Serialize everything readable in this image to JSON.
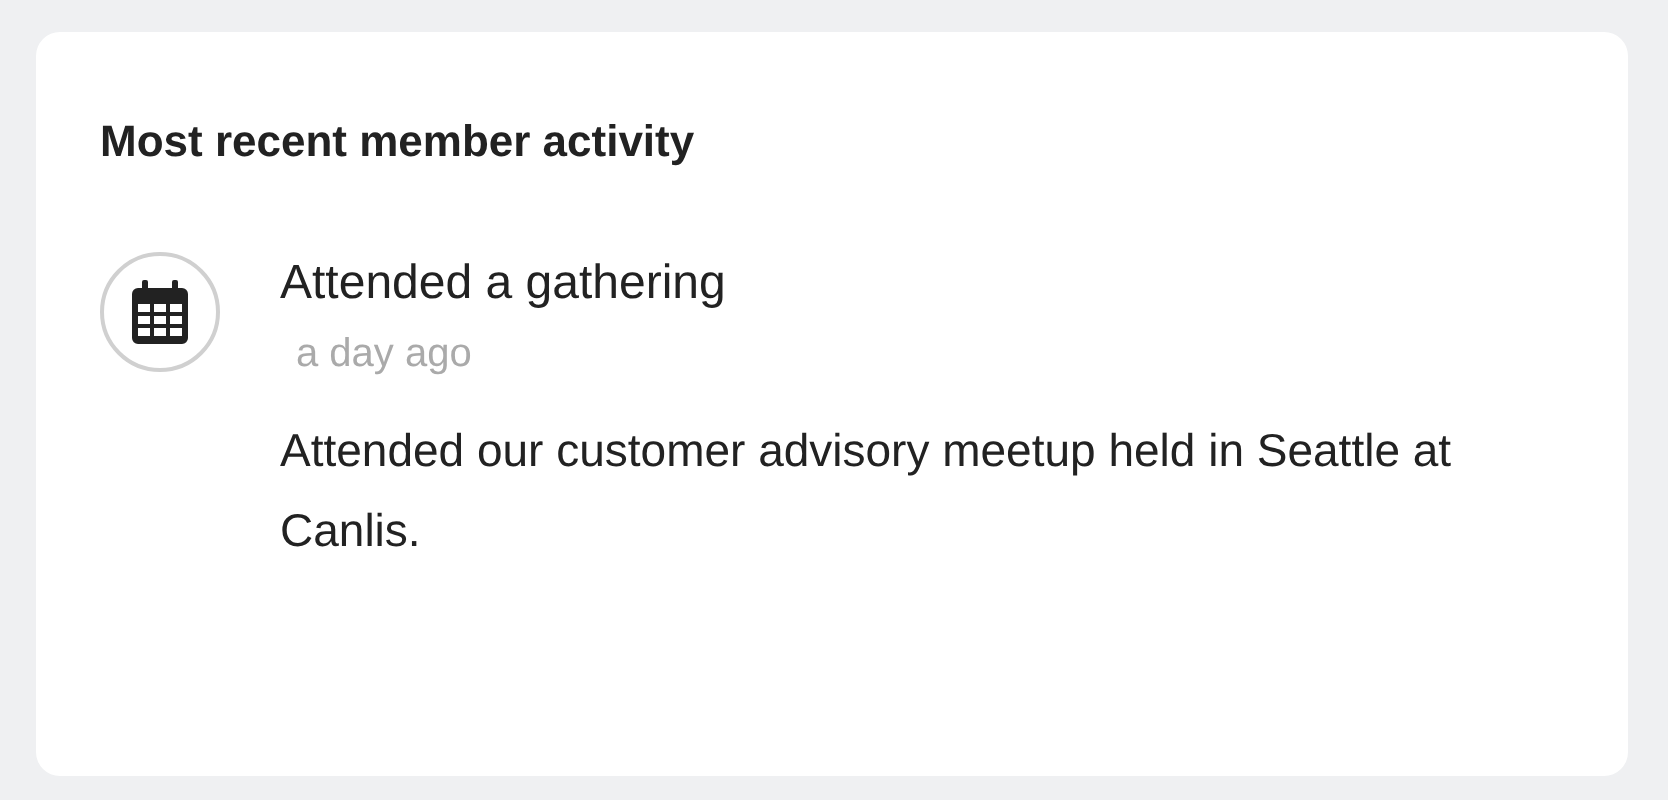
{
  "card": {
    "title": "Most recent member activity"
  },
  "activities": [
    {
      "kind": "event",
      "title": "Attended a gathering",
      "time": "a day ago",
      "description": "Attended our customer advisory meetup held in Seattle at Canlis."
    }
  ]
}
